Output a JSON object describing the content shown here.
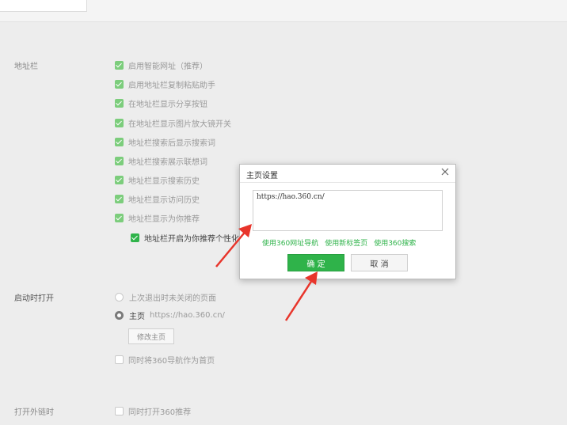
{
  "address_bar": {
    "label": "地址栏",
    "options": [
      "启用智能网址（推荐）",
      "启用地址栏复制粘贴助手",
      "在地址栏显示分享按钮",
      "在地址栏显示图片放大镜开关",
      "地址栏搜索后显示搜索词",
      "地址栏搜索展示联想词",
      "地址栏显示搜索历史",
      "地址栏显示访问历史",
      "地址栏显示为你推荐"
    ],
    "sub_option": "地址栏开启为你推荐个性化"
  },
  "startup": {
    "label": "启动时打开",
    "option_last": "上次退出时未关闭的页面",
    "option_home": "主页",
    "home_url": "https://hao.360.cn/",
    "modify_button": "修改主页",
    "also_360": "同时将360导航作为首页"
  },
  "external": {
    "label": "打开外链时",
    "option": "同时打开360推荐"
  },
  "dialog": {
    "title": "主页设置",
    "url_value": "https://hao.360.cn/",
    "link_nav": "使用360网址导航",
    "link_newtab": "使用新标签页",
    "link_search": "使用360搜索",
    "ok": "确 定",
    "cancel": "取 消"
  },
  "colors": {
    "accent": "#2fb34a",
    "arrow": "#e8352b"
  }
}
